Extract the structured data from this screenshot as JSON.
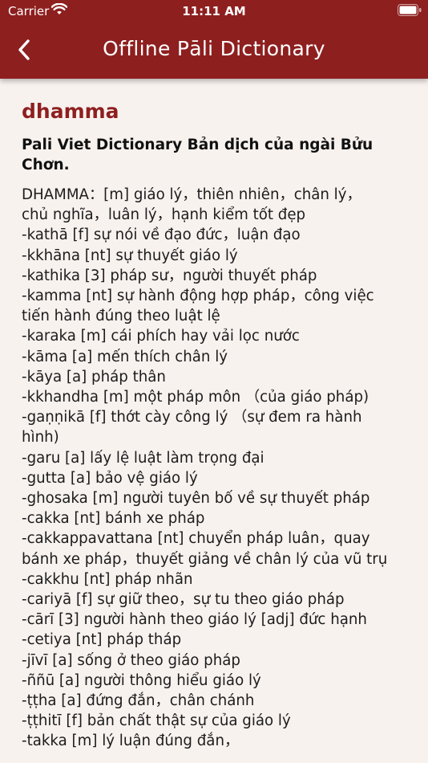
{
  "status_bar": {
    "carrier": "Carrier",
    "time": "11:11 AM"
  },
  "nav": {
    "title": "Offline Pāli Dictionary",
    "back_icon": "chevron-left"
  },
  "entry": {
    "headword": "dhamma",
    "source": "Pali Viet Dictionary  Bản dịch của ngài Bửu Chơn.",
    "definition": "DHAMMA：[m] giáo lý，thiên nhiên，chân lý，\nchủ nghĩa，luân lý，hạnh kiểm tốt đẹp\n-kathā [f] sự nói về đạo đức，luận đạo\n-kkhāna [nt] sự thuyết giáo lý\n-kathika [3] pháp sư，người thuyết pháp\n-kamma [nt] sự hành động hợp pháp，công việc\ntiến hành đúng theo luật lệ\n-karaka [m] cái phích hay vải lọc nước\n-kāma [a] mến thích chân lý\n-kāya [a] pháp thân\n-kkhandha [m] một pháp môn （của giáo pháp)\n-gaṇṇikā [f] thớt cày công lý （sự đem ra hành\nhình)\n-garu [a] lấy lệ luật làm trọng đại\n-gutta [a] bảo vệ giáo lý\n-ghosaka [m] người tuyên bố về sự thuyết pháp\n-cakka [nt] bánh xe pháp\n-cakkappavattana [nt] chuyển pháp luân，quay\nbánh xe pháp，thuyết giảng về chân lý của vũ trụ\n-cakkhu [nt] pháp nhãn\n-cariyā [f] sự giữ theo，sự tu theo giáo pháp\n-cārī [3] người hành theo giáo lý [adj] đức hạnh\n-cetiya [nt] pháp tháp\n-jīvī [a] sống ở theo giáo pháp\n-ññū [a] người thông hiểu giáo lý\n-ṭṭha [a] đứng đắn，chân chánh\n-ṭṭhitī [f] bản chất thật sự của giáo lý\n-takka [m] lý luận đúng đắn，"
  }
}
